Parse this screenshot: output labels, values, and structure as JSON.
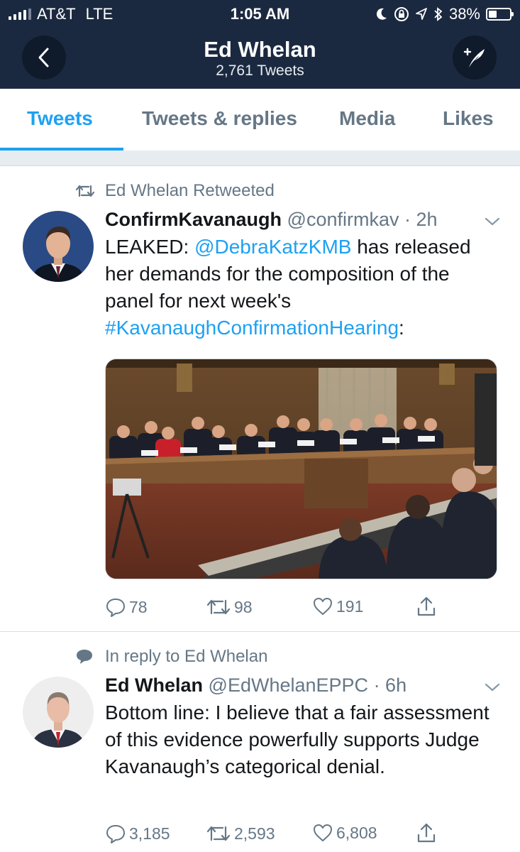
{
  "status_bar": {
    "carrier": "AT&T",
    "network": "LTE",
    "time": "1:05 AM",
    "battery": "38%",
    "battery_level": 0.38
  },
  "header": {
    "title": "Ed Whelan",
    "subtitle": "2,761 Tweets",
    "back_icon": "chevron-left-icon",
    "compose_icon": "compose-tweet-icon"
  },
  "tabs": [
    {
      "label": "Tweets",
      "active": true
    },
    {
      "label": "Tweets & replies",
      "active": false
    },
    {
      "label": "Media",
      "active": false
    },
    {
      "label": "Likes",
      "active": false
    }
  ],
  "tweets": [
    {
      "context": "Ed Whelan Retweeted",
      "context_icon": "retweet-icon",
      "name": "ConfirmKavanaugh",
      "handle": "@confirmkav",
      "time": "· 2h",
      "text": {
        "p1": "LEAKED: ",
        "mention": "@DebraKatzKMB",
        "p2": " has released her demands for the composition of the panel for next week's ",
        "hashtag": "#KavanaughConfirmationHearing",
        "p3": ":"
      },
      "stats": {
        "replies": "78",
        "retweets": "98",
        "likes": "191"
      }
    },
    {
      "context": "In reply to Ed Whelan",
      "context_icon": "reply-bubble-icon",
      "name": "Ed Whelan",
      "handle": "@EdWhelanEPPC",
      "time": "· 6h",
      "text": "Bottom line: I believe that a fair assessment of this evidence powerfully supports Judge Kavanaugh’s categorical denial.",
      "stats": {
        "replies": "3,185",
        "retweets": "2,593",
        "likes": "6,808"
      }
    }
  ],
  "colors": {
    "header_bg": "#1b2940",
    "accent": "#1da1f2",
    "muted": "#657786"
  }
}
